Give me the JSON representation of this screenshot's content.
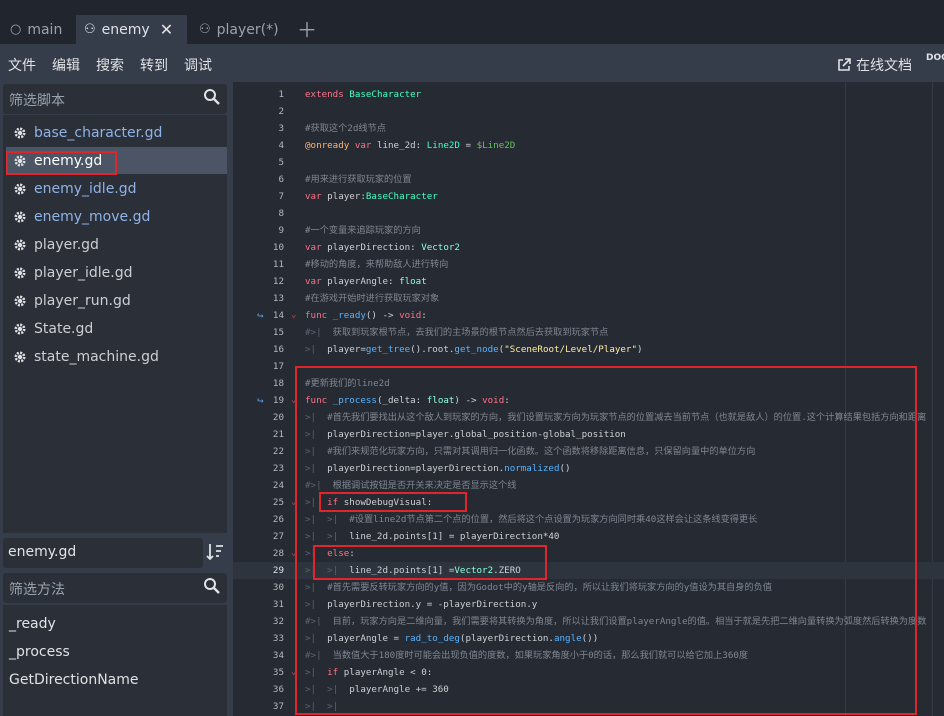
{
  "tabs": [
    {
      "label": "main",
      "icon": "circle-icon"
    },
    {
      "label": "enemy",
      "icon": "node-icon",
      "active": true
    },
    {
      "label": "player(*)",
      "icon": "node-icon"
    }
  ],
  "menu": {
    "items": [
      "文件",
      "编辑",
      "搜索",
      "转到",
      "调试"
    ],
    "online_docs": "在线文档",
    "docs_cut": "DOC"
  },
  "left_panel": {
    "filter_scripts_placeholder": "筛选脚本",
    "scripts": [
      "base_character.gd",
      "enemy.gd",
      "enemy_idle.gd",
      "enemy_move.gd",
      "player.gd",
      "player_idle.gd",
      "player_run.gd",
      "State.gd",
      "state_machine.gd"
    ],
    "current_script": "enemy.gd",
    "filter_methods_placeholder": "筛选方法",
    "methods": [
      "_ready",
      "_process",
      "GetDirectionName"
    ]
  },
  "code_lines": [
    {
      "n": "1",
      "text": "extends BaseCharacter"
    },
    {
      "n": "2",
      "text": ""
    },
    {
      "n": "3",
      "text": "#获取这个2d线节点"
    },
    {
      "n": "4",
      "text": "@onready var line_2d: Line2D = $Line2D"
    },
    {
      "n": "5",
      "text": ""
    },
    {
      "n": "6",
      "text": "#用来进行获取玩家的位置"
    },
    {
      "n": "7",
      "text": "var player:BaseCharacter"
    },
    {
      "n": "8",
      "text": ""
    },
    {
      "n": "9",
      "text": "#一个变量来追踪玩家的方向"
    },
    {
      "n": "10",
      "text": "var playerDirection: Vector2"
    },
    {
      "n": "11",
      "text": "#移动的角度，来帮助敌人进行转向"
    },
    {
      "n": "12",
      "text": "var playerAngle: float"
    },
    {
      "n": "13",
      "text": "#在游戏开始时进行获取玩家对象"
    },
    {
      "n": "14",
      "text": "func _ready() -> void:"
    },
    {
      "n": "15",
      "text": "获取到玩家根节点，去我们的主场景的根节点然后去获取到玩家节点"
    },
    {
      "n": "16",
      "text": "player=get_tree().root.get_node(\"SceneRoot/Level/Player\")"
    },
    {
      "n": "17",
      "text": ""
    },
    {
      "n": "18",
      "text": "#更新我们的line2d"
    },
    {
      "n": "19",
      "text": "func _process(_delta: float) -> void:"
    },
    {
      "n": "20",
      "text": "#首先我们要找出从这个敌人到玩家的方向，我们设置玩家方向为玩家节点的位置减去当前节点（也就是敌人）的位置.这个计算结果包括方向和距离"
    },
    {
      "n": "21",
      "text": "playerDirection=player.global_position-global_position"
    },
    {
      "n": "22",
      "text": "#我们来规范化玩家方向，只需对其调用归一化函数。这个函数将移除距离信息，只保留向量中的单位方向"
    },
    {
      "n": "23",
      "text": "playerDirection=playerDirection.normalized()"
    },
    {
      "n": "24",
      "text": "根据调试按钮是否开关来决定是否显示这个线"
    },
    {
      "n": "25",
      "text": "if showDebugVisual:"
    },
    {
      "n": "26",
      "text": "#设置line2d节点第二个点的位置，然后将这个点设置为玩家方向同时乘40这样会让这条线变得更长"
    },
    {
      "n": "27",
      "text": "line_2d.points[1] = playerDirection*40"
    },
    {
      "n": "28",
      "text": "else:"
    },
    {
      "n": "29",
      "text": "line_2d.points[1] =Vector2.ZERO"
    },
    {
      "n": "30",
      "text": "#首先需要反转玩家方向的y值，因为Godot中的y轴是反向的，所以让我们将玩家方向的y值设为其自身的负值"
    },
    {
      "n": "31",
      "text": "playerDirection.y = -playerDirection.y"
    },
    {
      "n": "32",
      "text": "目前，玩家方向是二维向量，我们需要将其转换为角度，所以让我们设置playerAngle的值。相当于就是先把二维向量转换为弧度然后转换为度数"
    },
    {
      "n": "33",
      "text": "playerAngle = rad_to_deg(playerDirection.angle())"
    },
    {
      "n": "34",
      "text": "当数值大于180度时可能会出现负值的度数，如果玩家角度小于0的话，那么我们就可以给它加上360度"
    },
    {
      "n": "35",
      "text": "if playerAngle < 0:"
    },
    {
      "n": "36",
      "text": "playerAngle += 360"
    },
    {
      "n": "37",
      "text": ""
    }
  ],
  "colors": {
    "keyword": "#ff7085",
    "type": "#42ffc2",
    "comment": "#808791",
    "function": "#57b3ff",
    "string": "#ffeda1",
    "highlight_box": "#e0262b"
  }
}
